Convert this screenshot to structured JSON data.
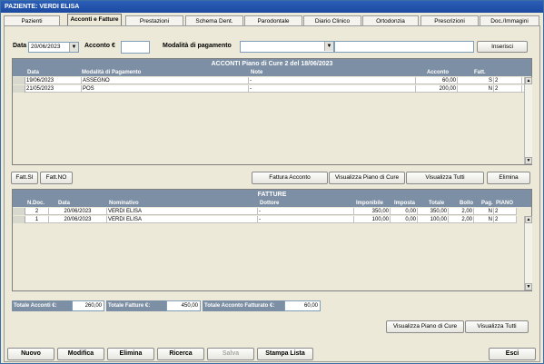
{
  "window": {
    "title": "PAZIENTE: VERDI ELISA"
  },
  "tabs": [
    {
      "label": "Pazienti"
    },
    {
      "label": "Acconti e Fatture"
    },
    {
      "label": "Prestazioni"
    },
    {
      "label": "Schema Dent."
    },
    {
      "label": "Parodontale"
    },
    {
      "label": "Diario Clinico"
    },
    {
      "label": "Ortodonzia"
    },
    {
      "label": "Prescrizioni"
    },
    {
      "label": "Doc./Immagini"
    }
  ],
  "form": {
    "date_label": "Data",
    "date_value": "20/06/2023",
    "acconto_label": "Acconto €",
    "acconto_value": "",
    "modalita_label": "Modalità di pagamento",
    "modalita_value": "",
    "note_value": "",
    "insert_button": "Inserisci"
  },
  "acconti": {
    "title": "ACCONTI Piano di Cure 2 del 18/06/2023",
    "headers": {
      "data": "Data",
      "modalita": "Modalità di Pagamento",
      "note": "Note",
      "acconto": "Acconto",
      "fatt": "Fatt."
    },
    "rows": [
      {
        "data": "19/06/2023",
        "modalita": "ASSEGNO",
        "note": "-",
        "acconto": "60,00",
        "fatt": "S",
        "n": "2"
      },
      {
        "data": "21/05/2023",
        "modalita": "POS",
        "note": "-",
        "acconto": "200,00",
        "fatt": "N",
        "n": "2"
      }
    ]
  },
  "actions": {
    "fatt_si": "Fatt.SI",
    "fatt_no": "Fatt.NO",
    "fattura_acconto": "Fattura Acconto",
    "visualizza_piano": "Visualizza Piano di Cure",
    "visualizza_tutti": "Visualizza Tutti",
    "elimina": "Elimina"
  },
  "fatture": {
    "title": "FATTURE",
    "headers": {
      "ndoc": "N.Doc.",
      "data": "Data",
      "nominativo": "Nominativo",
      "dottore": "Dottore",
      "imponibile": "Imponibile",
      "imposta": "Imposta",
      "totale": "Totale",
      "bollo": "Bollo",
      "pag": "Pag.",
      "piano": "PIANO"
    },
    "rows": [
      {
        "ndoc": "2",
        "data": "20/06/2023",
        "nominativo": "VERDI ELISA",
        "dottore": "-",
        "imponibile": "350,00",
        "imposta": "0,00",
        "totale": "350,00",
        "bollo": "2,00",
        "pag": "N",
        "piano": "2"
      },
      {
        "ndoc": "1",
        "data": "20/06/2023",
        "nominativo": "VERDI ELISA",
        "dottore": "-",
        "imponibile": "100,00",
        "imposta": "0,00",
        "totale": "100,00",
        "bollo": "2,00",
        "pag": "N",
        "piano": "2"
      }
    ]
  },
  "totals": {
    "acconti_label": "Totale Acconti €:",
    "acconti_value": "260,00",
    "fatture_label": "Totale Fatture €:",
    "fatture_value": "450,00",
    "fatturato_label": "Totale Acconto Fatturato €:",
    "fatturato_value": "60,00"
  },
  "bottom_actions": {
    "visualizza_piano": "Visualizza Piano di Cure",
    "visualizza_tutti": "Visualizza Tutti"
  },
  "footer": {
    "nuovo": "Nuovo",
    "modifica": "Modifica",
    "elimina": "Elimina",
    "ricerca": "Ricerca",
    "salva": "Salva",
    "stampa": "Stampa Lista",
    "esci": "Esci"
  },
  "colors": {
    "header_bg": "#7d8fa4",
    "titlebar": "#2b5fb8",
    "window_bg": "#ece9d8"
  }
}
